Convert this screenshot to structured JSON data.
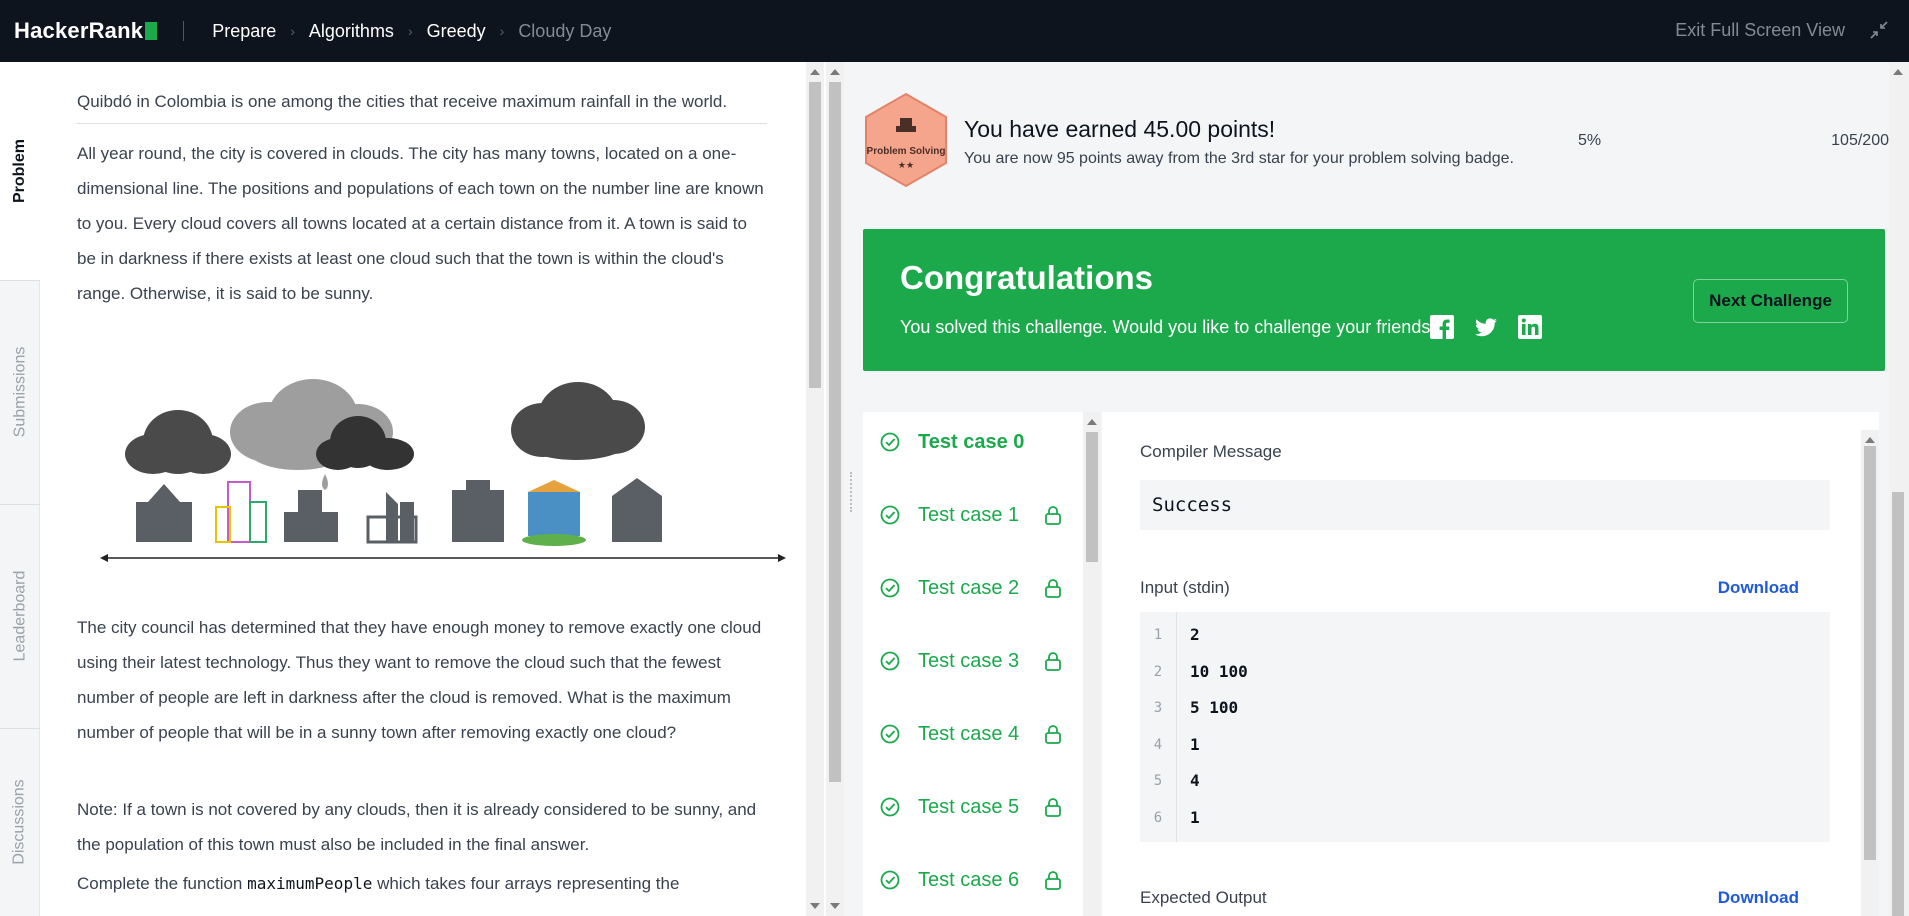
{
  "topbar": {
    "logo": "HackerRank",
    "breadcrumbs": [
      "Prepare",
      "Algorithms",
      "Greedy",
      "Cloudy Day"
    ],
    "exit_label": "Exit Full Screen View"
  },
  "vtabs": [
    "Problem",
    "Submissions",
    "Leaderboard",
    "Discussions"
  ],
  "problem": {
    "intro": "Quibdó in Colombia is one among the cities that receive maximum rainfall in the world.",
    "para1": "All year round, the city is covered in clouds. The city has many towns, located on a one-dimensional line. The positions and populations of each town on the number line are known to you. Every cloud covers all towns located at a certain distance from it. A town is said to be in darkness if there exists at least one cloud such that the town is within the cloud's range. Otherwise, it is said to be sunny.",
    "para2": "The city council has determined that they have enough money to remove exactly one cloud using their latest technology. Thus they want to remove the cloud such that the fewest number of people are left in darkness after the cloud is removed. What is the maximum number of people that will be in a sunny town after removing exactly one cloud?",
    "note": "Note: If a town is not covered by any clouds, then it is already considered to be sunny, and the population of this town must also be included in the final answer.",
    "complete_before": "Complete the function ",
    "complete_fn": "maximumPeople",
    "complete_after": " which takes four arrays representing the"
  },
  "result": {
    "badge_label": "Problem Solving",
    "badge_stars": "★★",
    "earned_title": "You have earned 45.00 points!",
    "earned_sub": "You are now 95 points away from the 3rd star for your problem solving badge.",
    "percent": "5%",
    "points": "105/200",
    "progress": 0.05
  },
  "congrats": {
    "title": "Congratulations",
    "subtitle": "You solved this challenge. Would you like to challenge your friends?",
    "next_button": "Next Challenge"
  },
  "tests": [
    {
      "label": "Test case 0",
      "locked": false
    },
    {
      "label": "Test case 1",
      "locked": true
    },
    {
      "label": "Test case 2",
      "locked": true
    },
    {
      "label": "Test case 3",
      "locked": true
    },
    {
      "label": "Test case 4",
      "locked": true
    },
    {
      "label": "Test case 5",
      "locked": true
    },
    {
      "label": "Test case 6",
      "locked": true
    }
  ],
  "detail": {
    "compiler_label": "Compiler Message",
    "compiler_value": "Success",
    "input_label": "Input (stdin)",
    "download_label": "Download",
    "input_lines": [
      {
        "n": "1",
        "v": "2"
      },
      {
        "n": "2",
        "v": "10 100"
      },
      {
        "n": "3",
        "v": "5 100"
      },
      {
        "n": "4",
        "v": "1"
      },
      {
        "n": "5",
        "v": "4"
      },
      {
        "n": "6",
        "v": "1"
      }
    ],
    "expected_label": "Expected Output"
  }
}
